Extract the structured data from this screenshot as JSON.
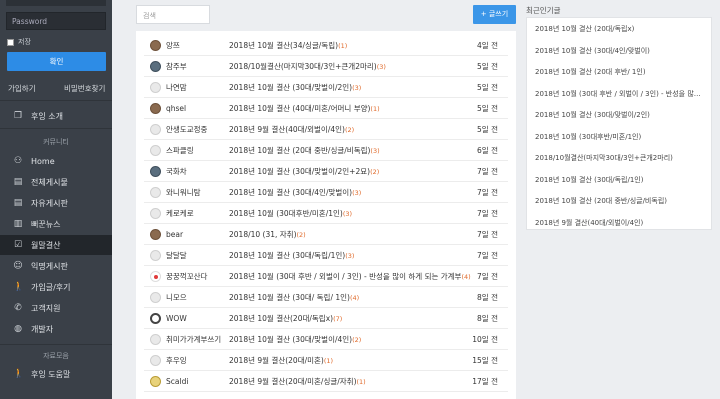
{
  "sidebar": {
    "password_placeholder": "Password",
    "remember_label": "저장",
    "login_label": "확인",
    "join_label": "가입하기",
    "find_pw_label": "비밀번호찾기",
    "intro_label": "후잉 소개",
    "community_section": "커뮤니티",
    "items": [
      {
        "label": "Home",
        "icon": "people-icon"
      },
      {
        "label": "전체게시물",
        "icon": "list-icon"
      },
      {
        "label": "자유게시판",
        "icon": "board-icon"
      },
      {
        "label": "뻐꾼뉴스",
        "icon": "news-icon"
      },
      {
        "label": "월말결산",
        "icon": "clipboard-icon"
      },
      {
        "label": "익명게시판",
        "icon": "mask-icon"
      },
      {
        "label": "가입글/후기",
        "icon": "walk-icon"
      },
      {
        "label": "고객지원",
        "icon": "phone-icon"
      },
      {
        "label": "개발자",
        "icon": "globe-icon"
      }
    ],
    "resources_section": "자료모음",
    "help_label": "후잉 도움말"
  },
  "main": {
    "search_placeholder": "검색",
    "write_label": "+ 글쓰기",
    "posts": [
      {
        "author": "앙쯔",
        "title": "2018년 10월 결산(34/싱글/독립)",
        "count": "(1)",
        "date": "4일 전",
        "avatar": "img"
      },
      {
        "author": "참주부",
        "title": "2018/10월결산(마지막30대/3인+큰개2마리)",
        "count": "(3)",
        "date": "5일 전",
        "avatar": "img2"
      },
      {
        "author": "나연맘",
        "title": "2018년 10월 결산 (30대/맞벌이/2인)",
        "count": "(3)",
        "date": "5일 전",
        "avatar": "default"
      },
      {
        "author": "qhsel",
        "title": "2018년 10월 결산 (40대/미혼/어머니 부양)",
        "count": "(1)",
        "date": "5일 전",
        "avatar": "img"
      },
      {
        "author": "안생도교정중",
        "title": "2018년 9월 결산(40대/외벌이/4인)",
        "count": "(2)",
        "date": "5일 전",
        "avatar": "default"
      },
      {
        "author": "스파클링",
        "title": "2018년 10월 결산 (20대 중반/싱글/비독립)",
        "count": "(3)",
        "date": "6일 전",
        "avatar": "default"
      },
      {
        "author": "국화차",
        "title": "2018년 10월 결산 (30대/맞벌이/2인+2묘)",
        "count": "(2)",
        "date": "7일 전",
        "avatar": "img2"
      },
      {
        "author": "와니워니탐",
        "title": "2018년 10월 결산 (30대/4인/맞벌이)",
        "count": "(3)",
        "date": "7일 전",
        "avatar": "default"
      },
      {
        "author": "케로케로",
        "title": "2018년 10월 (30대후반/미혼/1인)",
        "count": "(3)",
        "date": "7일 전",
        "avatar": "default"
      },
      {
        "author": "bear",
        "title": "2018/10 (31, 자취)",
        "count": "(2)",
        "date": "7일 전",
        "avatar": "img"
      },
      {
        "author": "달달달",
        "title": "2018년 10월 결산 (30대/독립/1인)",
        "count": "(3)",
        "date": "7일 전",
        "avatar": "default"
      },
      {
        "author": "꿍꿍꺽꼬산다",
        "title": "2018년 10월 (30대 후반 / 외벌이 / 3인) - 반성을 많이 하게 되는 가계부",
        "count": "(4)",
        "date": "7일 전",
        "avatar": "red"
      },
      {
        "author": "니모으",
        "title": "2018년 10월 결산 (30대/ 독립/ 1인)",
        "count": "(4)",
        "date": "8일 전",
        "avatar": "default"
      },
      {
        "author": "WOW",
        "title": "2018년 10월 결산(20대/독립x)",
        "count": "(7)",
        "date": "8일 전",
        "avatar": "ring"
      },
      {
        "author": "취미가가계부쓰기",
        "title": "2018년 10월 결산 (30대/맞벌이/4인)",
        "count": "(2)",
        "date": "10일 전",
        "avatar": "default"
      },
      {
        "author": "후우잉",
        "title": "2018년 9월 결산(20대/미혼)",
        "count": "(1)",
        "date": "15일 전",
        "avatar": "default"
      },
      {
        "author": "Scaldi",
        "title": "2018년 9월 결산(20대/미혼/싱글/자취)",
        "count": "(1)",
        "date": "17일 전",
        "avatar": "yellow"
      }
    ]
  },
  "right": {
    "title": "최근인기글",
    "items": [
      "2018년 10월 결산 (20대/독립x)",
      "2018년 10월 결산 (30대/4인/맞벌이)",
      "2018년 10월 결산 (20대 후반/ 1인)",
      "2018년 10월 (30대 후반 / 외벌이 / 3인) - 반성을 많이 하게 되는 가계부",
      "2018년 10월 결산 (30대/맞벌이/2인)",
      "2018년 10월 (30대후반/미혼/1인)",
      "2018/10월결산(마지막30대/3인+큰개2마리)",
      "2018년 10월 결산 (30대/독립/1인)",
      "2018년 10월 결산 (20대 중반/싱글/비독립)",
      "2018년 9월 결산(40대/외벌이/4인)"
    ]
  }
}
